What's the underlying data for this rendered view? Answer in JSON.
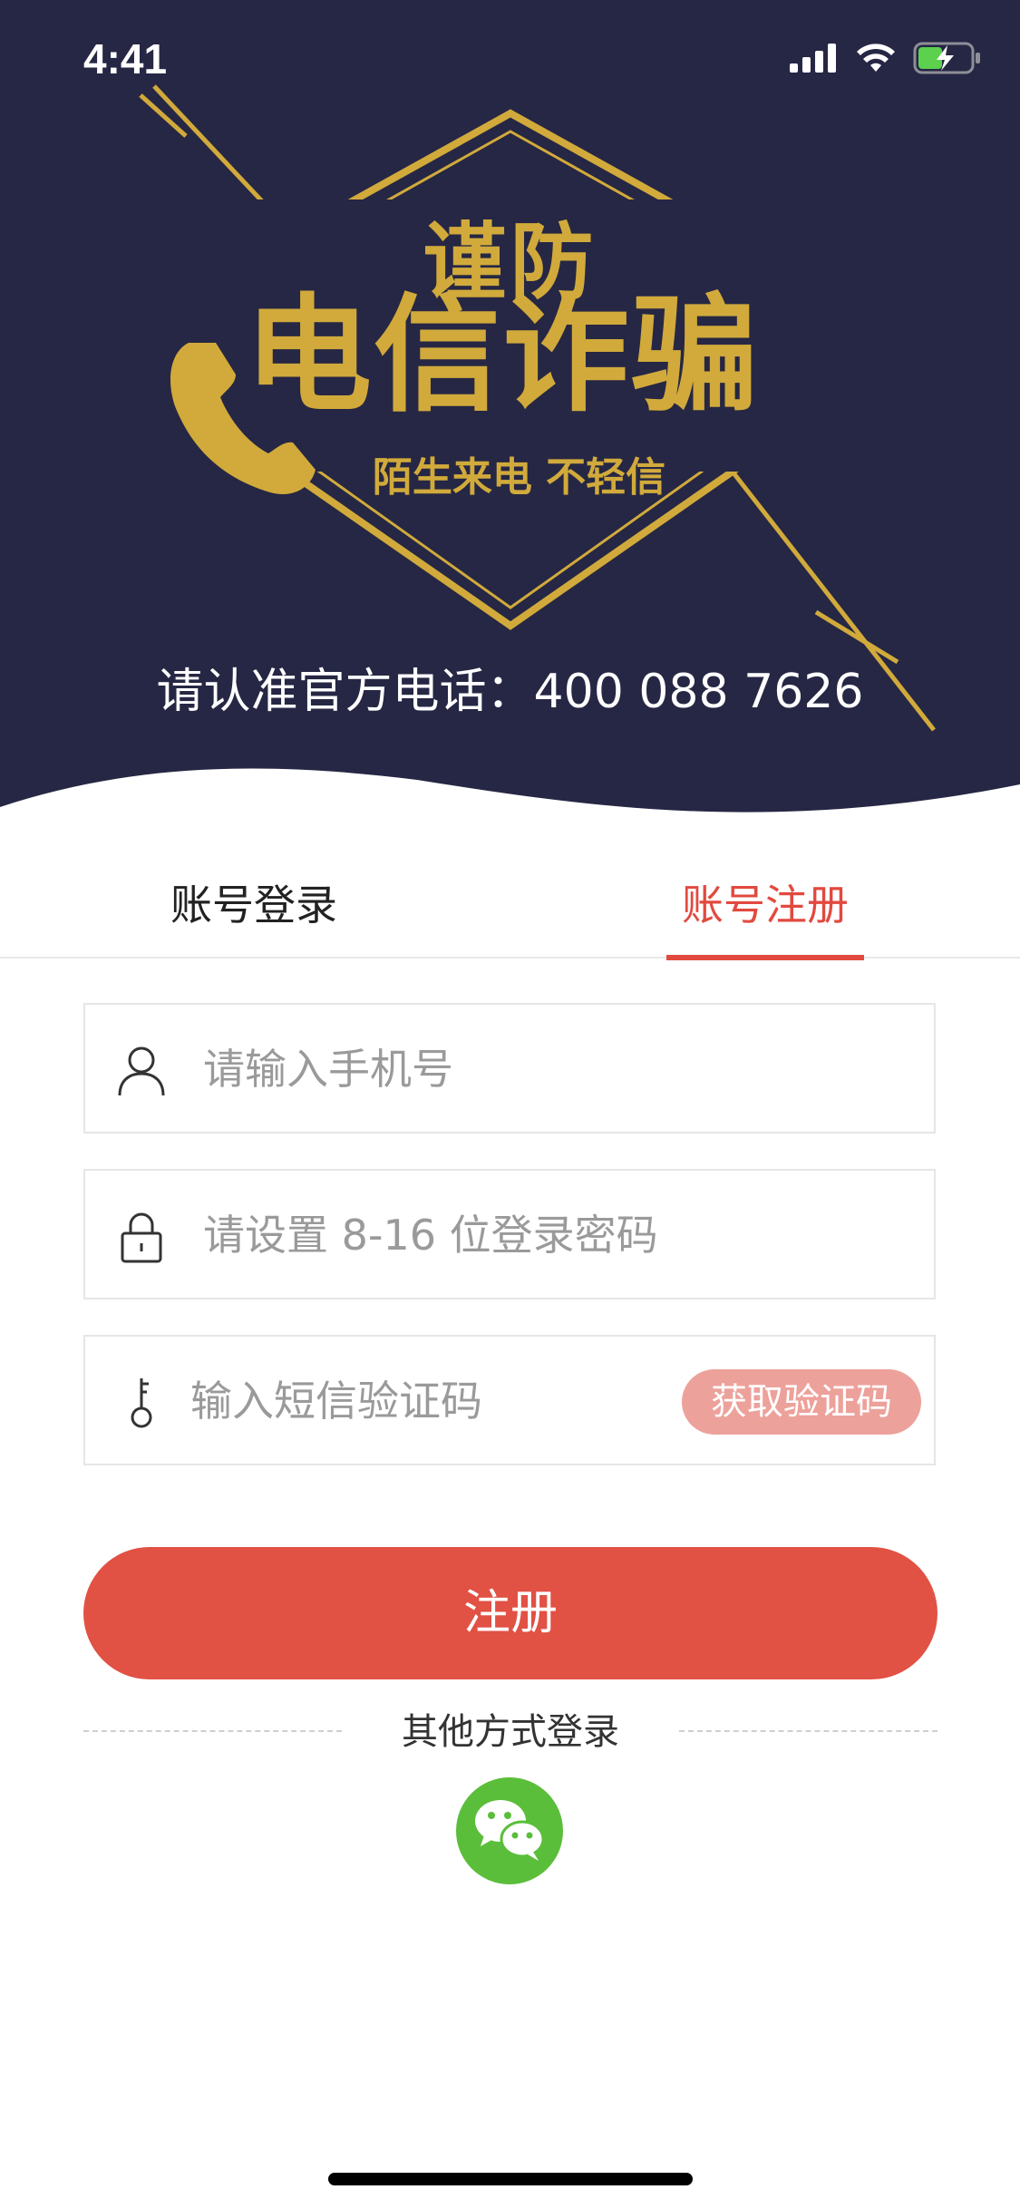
{
  "status_bar": {
    "time": "4:41",
    "signal_icon": "cellular-signal-icon",
    "wifi_icon": "wifi-icon",
    "battery_icon": "battery-charging-icon"
  },
  "poster": {
    "title_small": "谨防",
    "title_big": "电信诈骗",
    "tagline": "陌生来电 不轻信",
    "hotline": "请认准官方电话：400 088 7626",
    "icon": "phone-handset-icon"
  },
  "tabs": [
    {
      "label": "账号登录",
      "active": false
    },
    {
      "label": "账号注册",
      "active": true
    }
  ],
  "form": {
    "phone": {
      "placeholder": "请输入手机号",
      "value": "",
      "icon": "user-icon"
    },
    "password": {
      "placeholder": "请设置 8-16 位登录密码",
      "value": "",
      "icon": "lock-icon"
    },
    "sms_code": {
      "placeholder": "输入短信验证码",
      "value": "",
      "icon": "key-icon"
    },
    "sms_button": "获取验证码",
    "submit": "注册"
  },
  "other_login": {
    "label": "其他方式登录",
    "wechat_icon": "wechat-icon"
  },
  "colors": {
    "banner_bg": "#262744",
    "gold": "#d1aa3b",
    "accent_red": "#e15144",
    "sms_button_bg": "#eda19b",
    "wechat_green": "#5bbe3a"
  }
}
